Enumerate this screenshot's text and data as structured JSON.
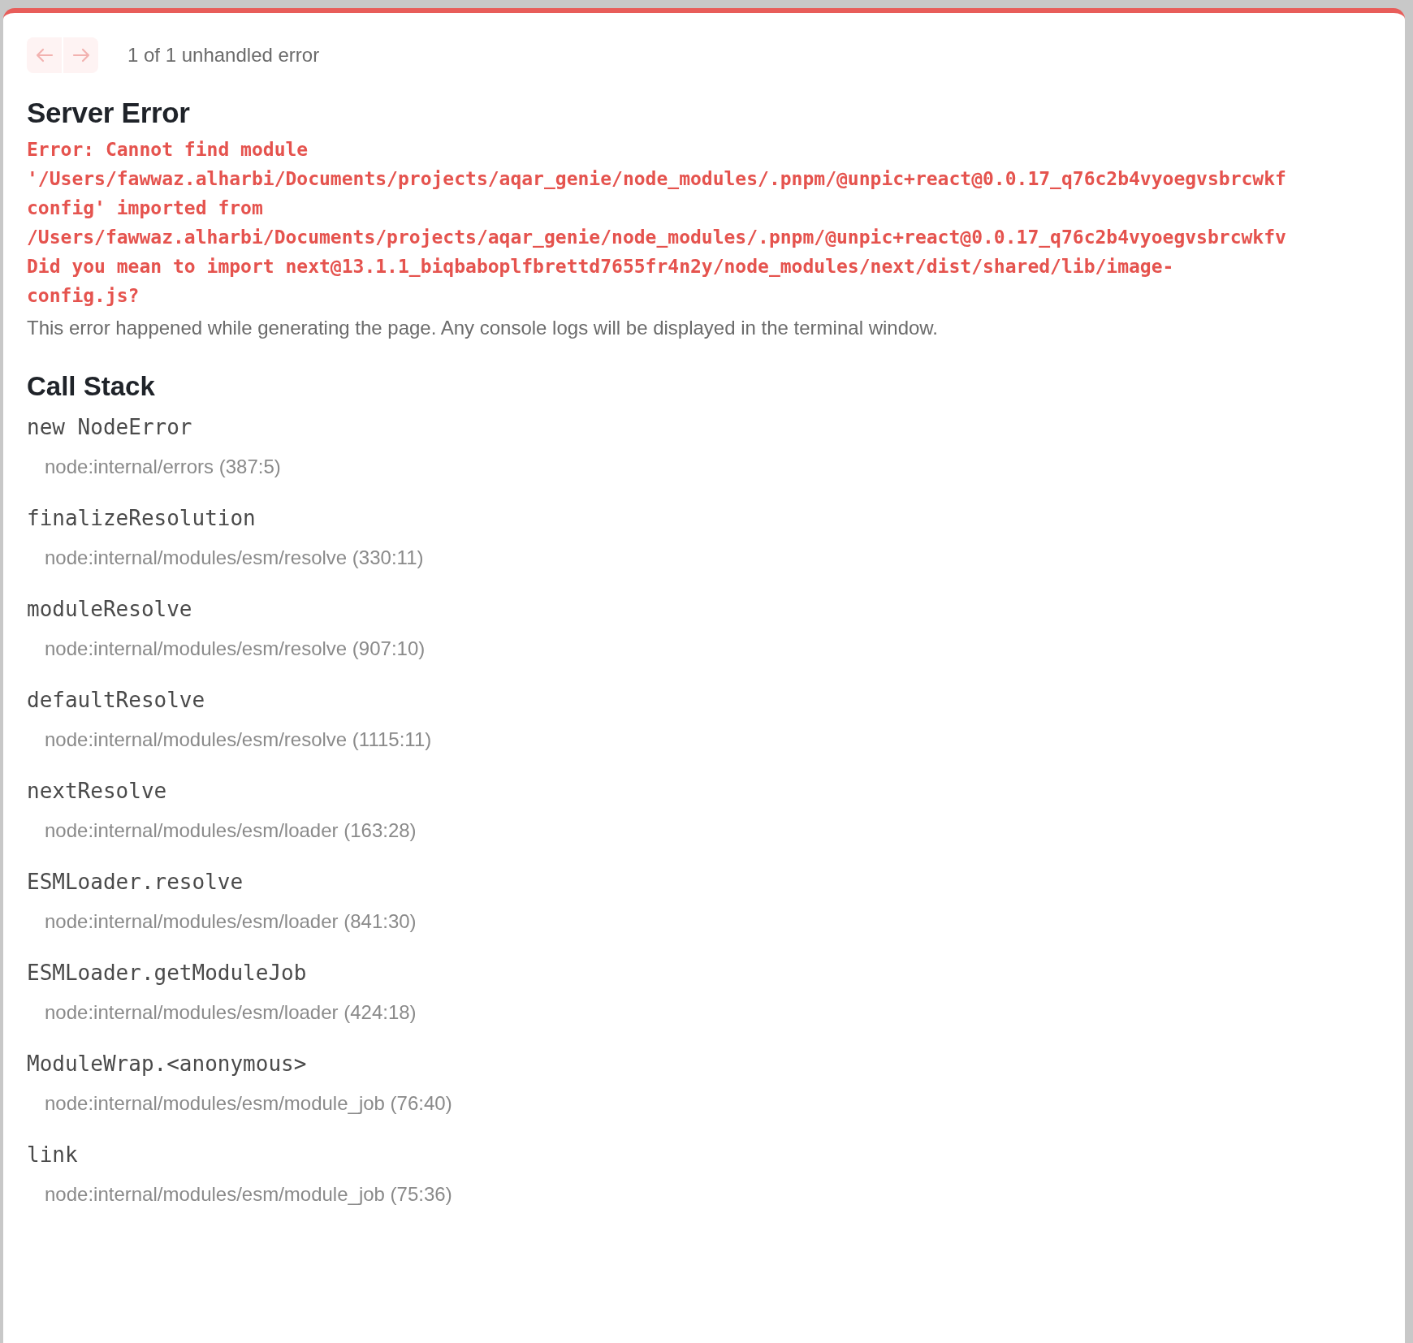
{
  "navigation": {
    "buttons": [
      {
        "kind": "previous",
        "disabled": true
      },
      {
        "kind": "next",
        "disabled": true
      }
    ],
    "counter": "1 of 1 unhandled error"
  },
  "title": "Server Error",
  "error_message": [
    "Error: Cannot find module",
    "'/Users/fawwaz.alharbi/Documents/projects/aqar_genie/node_modules/.pnpm/@unpic+react@0.0.17_q76c2b4vyoegvsbrcwkf",
    "config' imported from",
    "/Users/fawwaz.alharbi/Documents/projects/aqar_genie/node_modules/.pnpm/@unpic+react@0.0.17_q76c2b4vyoegvsbrcwkfv",
    "Did you mean to import next@13.1.1_biqbaboplfbrettd7655fr4n2y/node_modules/next/dist/shared/lib/image-",
    "config.js?"
  ],
  "description": "This error happened while generating the page. Any console logs will be displayed in the terminal window.",
  "call_stack": {
    "title": "Call Stack",
    "frames": [
      {
        "function": "new NodeError",
        "location": "node:internal/errors (387:5)"
      },
      {
        "function": "finalizeResolution",
        "location": "node:internal/modules/esm/resolve (330:11)"
      },
      {
        "function": "moduleResolve",
        "location": "node:internal/modules/esm/resolve (907:10)"
      },
      {
        "function": "defaultResolve",
        "location": "node:internal/modules/esm/resolve (1115:11)"
      },
      {
        "function": "nextResolve",
        "location": "node:internal/modules/esm/loader (163:28)"
      },
      {
        "function": "ESMLoader.resolve",
        "location": "node:internal/modules/esm/loader (841:30)"
      },
      {
        "function": "ESMLoader.getModuleJob",
        "location": "node:internal/modules/esm/loader (424:18)"
      },
      {
        "function": "ModuleWrap.<anonymous>",
        "location": "node:internal/modules/esm/module_job (76:40)"
      },
      {
        "function": "link",
        "location": "node:internal/modules/esm/module_job (75:36)"
      }
    ]
  }
}
